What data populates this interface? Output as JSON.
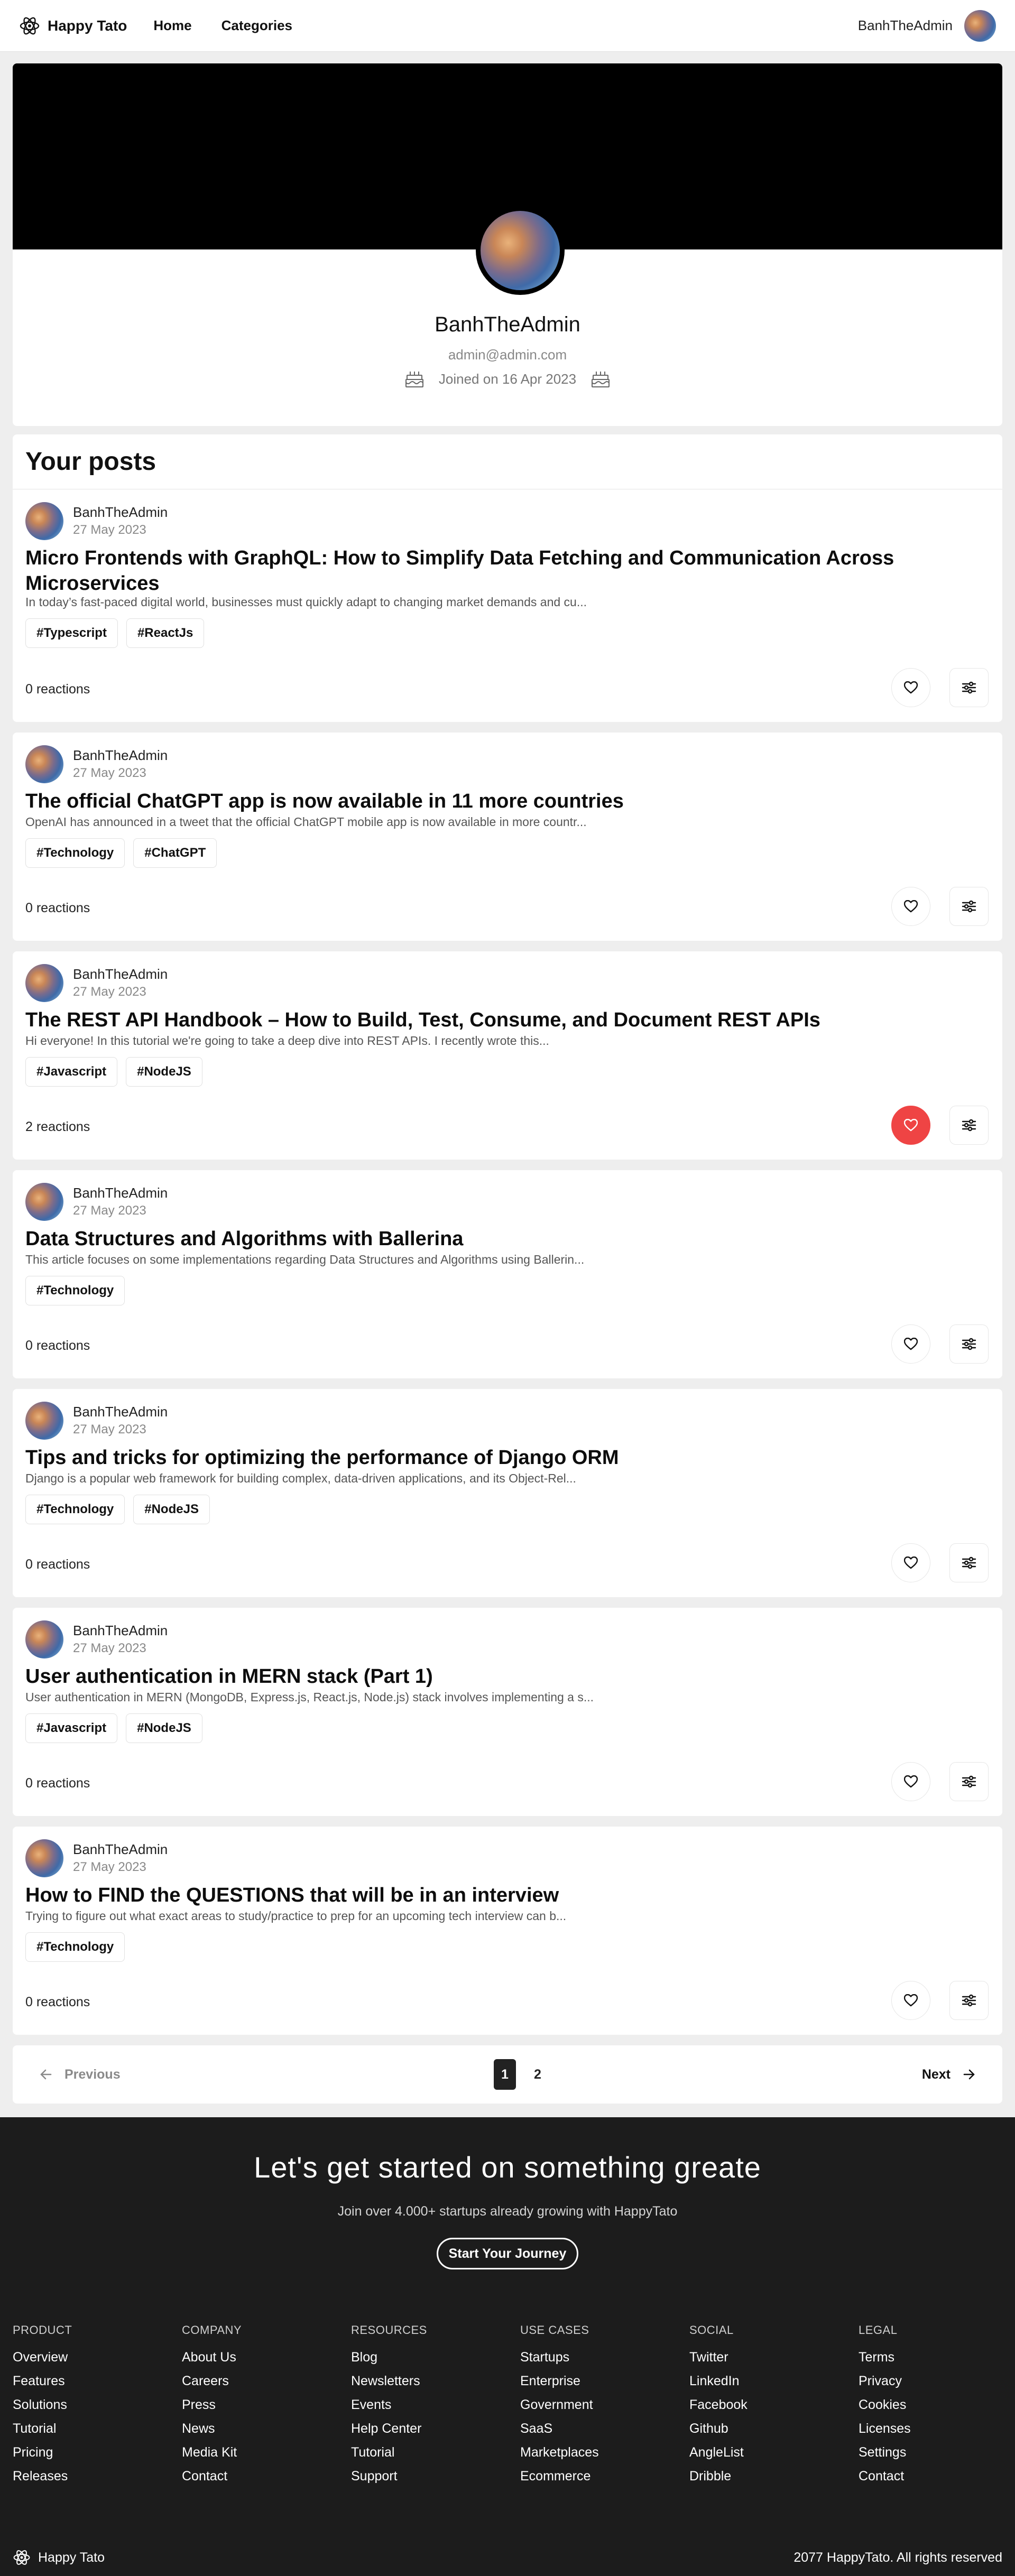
{
  "nav": {
    "brand": "Happy Tato",
    "links": [
      "Home",
      "Categories"
    ],
    "username": "BanhTheAdmin"
  },
  "profile": {
    "name": "BanhTheAdmin",
    "email": "admin@admin.com",
    "joined": "Joined on 16 Apr 2023"
  },
  "posts_heading": "Your posts",
  "posts": [
    {
      "author": "BanhTheAdmin",
      "date": "27 May 2023",
      "title": "Micro Frontends with GraphQL: How to Simplify Data Fetching and Communication Across Microservices",
      "excerpt": "In today’s fast-paced digital world, businesses must quickly adapt to changing market demands and cu...",
      "tags": [
        "#Typescript",
        "#ReactJs"
      ],
      "reactions": "0 reactions",
      "liked": false
    },
    {
      "author": "BanhTheAdmin",
      "date": "27 May 2023",
      "title": "The official ChatGPT app is now available in 11 more countries",
      "excerpt": "OpenAI has announced in a tweet that the official ChatGPT mobile app is now available in more countr...",
      "tags": [
        "#Technology",
        "#ChatGPT"
      ],
      "reactions": "0 reactions",
      "liked": false
    },
    {
      "author": "BanhTheAdmin",
      "date": "27 May 2023",
      "title": "The REST API Handbook – How to Build, Test, Consume, and Document REST APIs",
      "excerpt": "Hi everyone! In this tutorial we're going to take a deep dive into REST APIs. I recently wrote this...",
      "tags": [
        "#Javascript",
        "#NodeJS"
      ],
      "reactions": "2 reactions",
      "liked": true
    },
    {
      "author": "BanhTheAdmin",
      "date": "27 May 2023",
      "title": "Data Structures and Algorithms with Ballerina",
      "excerpt": "This article focuses on some implementations regarding Data Structures and Algorithms using Ballerin...",
      "tags": [
        "#Technology"
      ],
      "reactions": "0 reactions",
      "liked": false
    },
    {
      "author": "BanhTheAdmin",
      "date": "27 May 2023",
      "title": "Tips and tricks for optimizing the performance of Django ORM",
      "excerpt": "Django is a popular web framework for building complex, data-driven applications, and its Object-Rel...",
      "tags": [
        "#Technology",
        "#NodeJS"
      ],
      "reactions": "0 reactions",
      "liked": false
    },
    {
      "author": "BanhTheAdmin",
      "date": "27 May 2023",
      "title": "User authentication in MERN stack (Part 1)",
      "excerpt": "User authentication in MERN (MongoDB, Express.js, React.js, Node.js) stack involves implementing a s...",
      "tags": [
        "#Javascript",
        "#NodeJS"
      ],
      "reactions": "0 reactions",
      "liked": false
    },
    {
      "author": "BanhTheAdmin",
      "date": "27 May 2023",
      "title": "How to FIND the QUESTIONS that will be in an interview",
      "excerpt": "Trying to figure out what exact areas to study/practice to prep for an upcoming tech interview can b...",
      "tags": [
        "#Technology"
      ],
      "reactions": "0 reactions",
      "liked": false
    }
  ],
  "pagination": {
    "previous": "Previous",
    "next": "Next",
    "pages": [
      "1",
      "2"
    ],
    "current": "1"
  },
  "footer": {
    "cta_title": "Let's get started on something greate",
    "cta_subtitle": "Join over 4.000+ startups already growing with HappyTato",
    "cta_button": "Start Your Journey",
    "columns": [
      {
        "heading": "PRODUCT",
        "links": [
          "Overview",
          "Features",
          "Solutions",
          "Tutorial",
          "Pricing",
          "Releases"
        ]
      },
      {
        "heading": "COMPANY",
        "links": [
          "About Us",
          "Careers",
          "Press",
          "News",
          "Media Kit",
          "Contact"
        ]
      },
      {
        "heading": "RESOURCES",
        "links": [
          "Blog",
          "Newsletters",
          "Events",
          "Help Center",
          "Tutorial",
          "Support"
        ]
      },
      {
        "heading": "USE CASES",
        "links": [
          "Startups",
          "Enterprise",
          "Government",
          "SaaS",
          "Marketplaces",
          "Ecommerce"
        ]
      },
      {
        "heading": "SOCIAL",
        "links": [
          "Twitter",
          "LinkedIn",
          "Facebook",
          "Github",
          "AngleList",
          "Dribble"
        ]
      },
      {
        "heading": "LEGAL",
        "links": [
          "Terms",
          "Privacy",
          "Cookies",
          "Licenses",
          "Settings",
          "Contact"
        ]
      }
    ],
    "brand": "Happy Tato",
    "copyright": "2077 HappyTato. All rights reserved"
  },
  "colors": {
    "liked_accent": "#ef4444",
    "footer_bg": "#1c1c1c",
    "cover_bg": "#000000"
  }
}
